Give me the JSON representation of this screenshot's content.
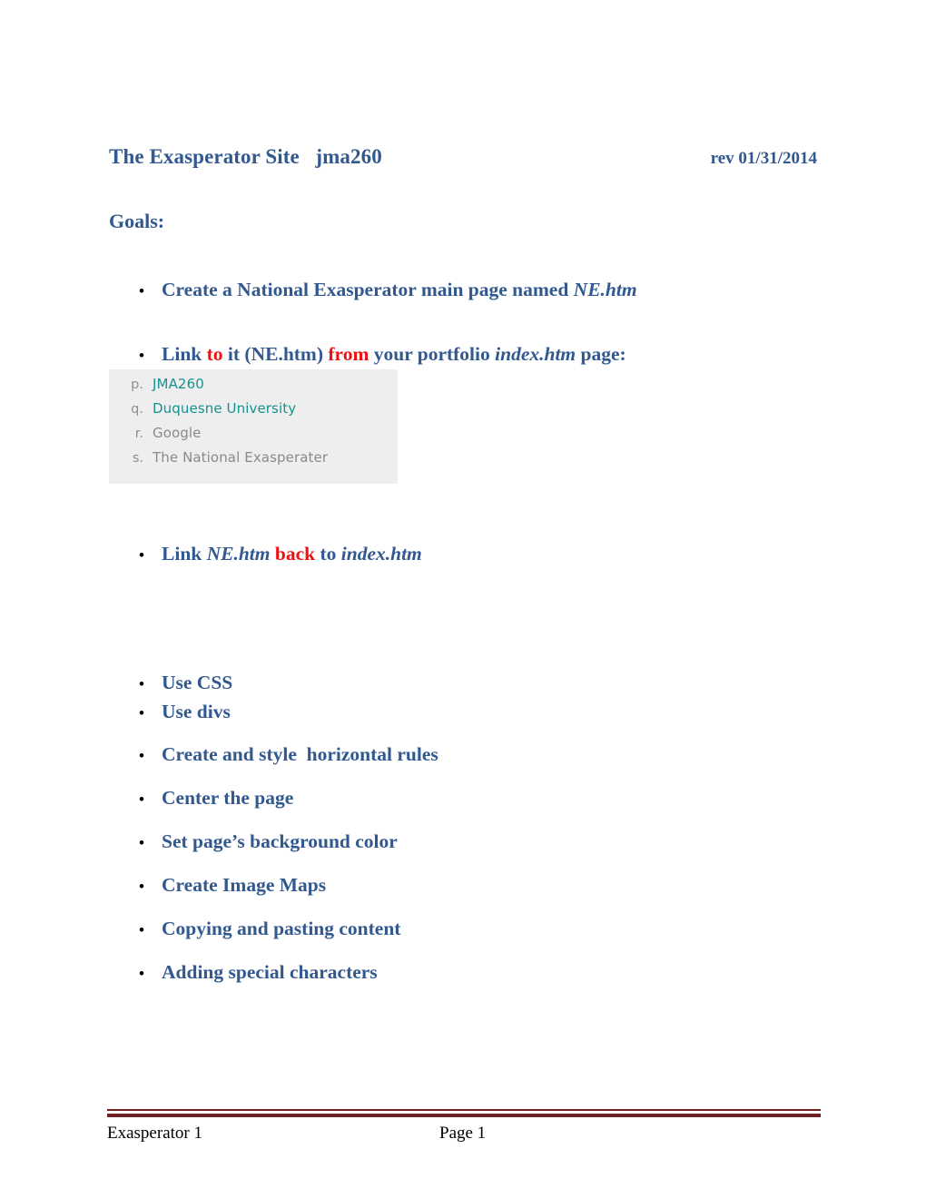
{
  "document": {
    "title_main": "The Exasperator Site   jma260",
    "revision": "rev 01/31/2014",
    "section_heading": "Goals:",
    "colors": {
      "heading_blue": "#31588f",
      "emphasis_red": "#ee1111",
      "footer_rule": "#6d1f22",
      "embedded_bg": "#eeeeee",
      "embedded_link_teal": "#17918f",
      "embedded_text_gray": "#8a8a8a"
    }
  },
  "bullets": [
    {
      "marker": "•",
      "parts": [
        {
          "text": "Create a National Exasperator main page named ",
          "style": "normal"
        },
        {
          "text": "NE.htm",
          "style": "italic"
        }
      ],
      "plain": "Create a National Exasperator main page named NE.htm"
    },
    {
      "marker": "•",
      "parts": [
        {
          "text": "Link ",
          "style": "normal"
        },
        {
          "text": "to",
          "style": "red"
        },
        {
          "text": " it (NE.htm) ",
          "style": "normal"
        },
        {
          "text": "from",
          "style": "red"
        },
        {
          "text": " your portfolio ",
          "style": "normal"
        },
        {
          "text": "index.htm",
          "style": "italic"
        },
        {
          "text": " page:",
          "style": "normal"
        }
      ],
      "plain": "Link to it (NE.htm) from your portfolio index.htm page:"
    },
    {
      "marker": "•",
      "parts": [
        {
          "text": "Link ",
          "style": "normal"
        },
        {
          "text": "NE.htm",
          "style": "italic"
        },
        {
          "text": " ",
          "style": "normal"
        },
        {
          "text": "back",
          "style": "red"
        },
        {
          "text": " to ",
          "style": "normal"
        },
        {
          "text": "index.htm",
          "style": "italic"
        }
      ],
      "plain": "Link NE.htm back to index.htm"
    },
    {
      "marker": "•",
      "parts": [
        {
          "text": "Use CSS",
          "style": "normal"
        }
      ],
      "plain": "Use CSS"
    },
    {
      "marker": "•",
      "parts": [
        {
          "text": "Use divs",
          "style": "normal"
        }
      ],
      "plain": "Use divs"
    },
    {
      "marker": "•",
      "parts": [
        {
          "text": "Create and style  horizontal rules",
          "style": "normal"
        }
      ],
      "plain": "Create and style  horizontal rules"
    },
    {
      "marker": "•",
      "parts": [
        {
          "text": "Center the page",
          "style": "normal"
        }
      ],
      "plain": "Center the page"
    },
    {
      "marker": "•",
      "parts": [
        {
          "text": "Set page’s background color",
          "style": "normal"
        }
      ],
      "plain": "Set page’s background color"
    },
    {
      "marker": "•",
      "parts": [
        {
          "text": "Create Image Maps",
          "style": "normal"
        }
      ],
      "plain": "Create Image Maps"
    },
    {
      "marker": "•",
      "parts": [
        {
          "text": "Copying and pasting content",
          "style": "normal"
        }
      ],
      "plain": "Copying and pasting content"
    },
    {
      "marker": "•",
      "parts": [
        {
          "text": "Adding special characters",
          "style": "normal"
        }
      ],
      "plain": "Adding special characters"
    }
  ],
  "embedded_screenshot": {
    "items": [
      {
        "marker": "p.",
        "label": "JMA260",
        "color": "teal"
      },
      {
        "marker": "q.",
        "label": "Duquesne University",
        "color": "teal"
      },
      {
        "marker": "r.",
        "label": "Google",
        "color": "gray"
      },
      {
        "marker": "s.",
        "label": "The National Exasperater",
        "color": "gray"
      }
    ]
  },
  "footer": {
    "left": "Exasperator 1",
    "center": "Page 1"
  }
}
